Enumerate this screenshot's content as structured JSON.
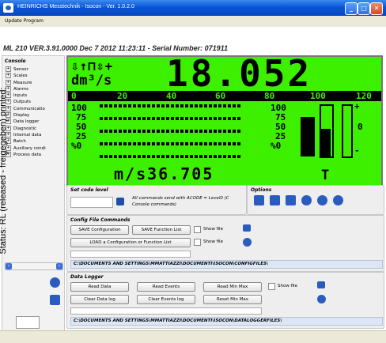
{
  "window": {
    "title": "HEINRICHS Messtechnik - Isocon - Ver. 1.0.2.0",
    "min_glyph": "_",
    "max_glyph": "□",
    "close_glyph": "✕"
  },
  "menu": {
    "update_program": "Update Program"
  },
  "info": {
    "line": "ML 210 VER.3.91.0000 Dec 7 2012 11:23:11  -  Serial Number: 071911"
  },
  "console": {
    "header": "Console",
    "items": [
      "Sensor",
      "Scales",
      "Measure",
      "Alarms",
      "Inputs",
      "Outputs",
      "Communicatio",
      "Display",
      "Data logger",
      "Diagnostic",
      "Internal data",
      "Batch",
      "Auxiliary condi",
      "Process data"
    ],
    "expander": "+",
    "scroll_left": "‹",
    "scroll_right": "›"
  },
  "lcd": {
    "symbols": "⇩↑⊓⇳+",
    "unit": "dm³/s",
    "main_value": "18.052",
    "scale_marks": [
      "0",
      "20",
      "40",
      "60",
      "80",
      "100",
      "120"
    ],
    "left_axis": [
      "100",
      "75",
      "50",
      "25",
      "%0"
    ],
    "right_axis": [
      "100",
      "75",
      "50",
      "25",
      "%0"
    ],
    "bottom_value": "m/s36.705",
    "flag": "T",
    "bar_tick_plus": "+",
    "bar_tick_zero": "0",
    "bar_tick_minus": "-",
    "bar_fill_fraction": 0.55
  },
  "set_code": {
    "title": "Set code level",
    "note_line1": "All commands send with ACODE = Level0 (C",
    "note_line2": "Console commands)"
  },
  "options": {
    "title": "Options"
  },
  "config": {
    "title": "Config File Commands",
    "save_config": "SAVE Configuration",
    "save_function_list": "SAVE Function List",
    "load_config": "LOAD a Configuration or Function List",
    "show_file": "Show file",
    "path": "C:\\DOCUMENTS AND SETTINGS\\MMATTIAZZI\\DOCUMENTI\\ISOCON\\CONFIGFILES\\"
  },
  "datalogger": {
    "title": "Data Logger",
    "read_data": "Read Data",
    "read_events": "Read Events",
    "read_min_max": "Read Min Max",
    "clear_data_log": "Clear Data log",
    "clear_events_log": "Clear Events log",
    "reset_min_max": "Reset Min Max",
    "show_file": "Show file",
    "path": "C:\\DOCUMENTS AND SETTINGS\\MMATTIAZZI\\DOCUMENTI\\ISOCON\\DATALOGGERFILES\\"
  },
  "watermark": {
    "text": "Status: RL (released - freigegeben) printed:"
  },
  "colors": {
    "lcd_green": "#3cf000",
    "titlebar_blue": "#0a56d8",
    "icon_blue": "#2a5bbf"
  }
}
